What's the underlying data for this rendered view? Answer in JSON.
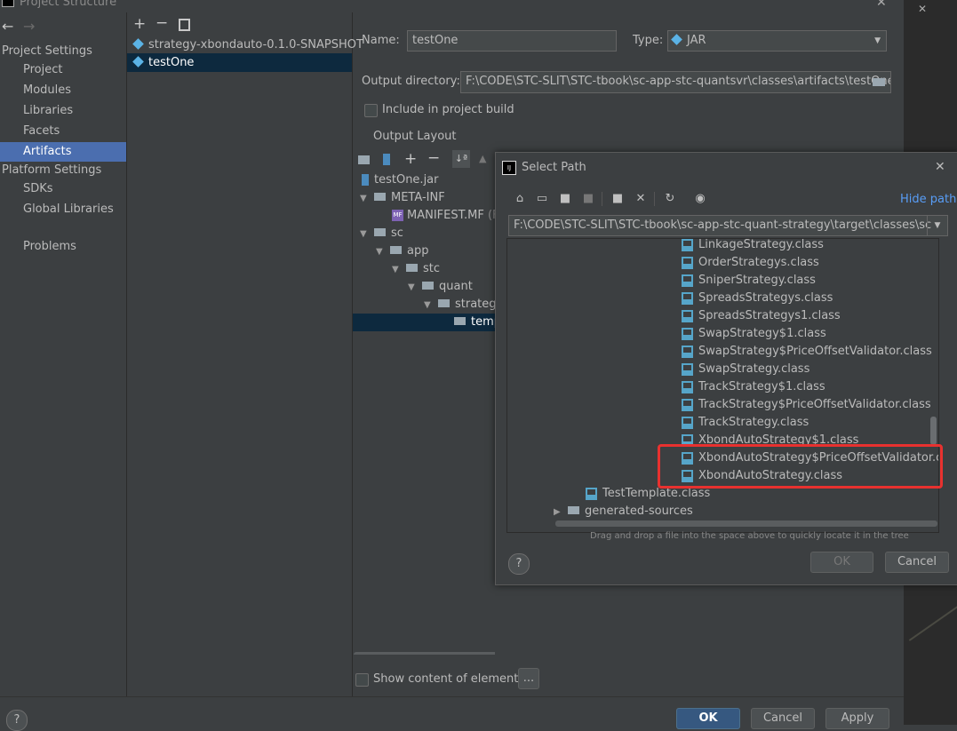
{
  "window": {
    "title": "Project Structure"
  },
  "nav": {
    "project_settings": "Project Settings",
    "items1": [
      "Project",
      "Modules",
      "Libraries",
      "Facets",
      "Artifacts"
    ],
    "platform_settings": "Platform Settings",
    "items2": [
      "SDKs",
      "Global Libraries"
    ],
    "problems": "Problems"
  },
  "artifacts": [
    "strategy-xbondauto-0.1.0-SNAPSHOT",
    "testOne"
  ],
  "form": {
    "name_label": "Name:",
    "name_value": "testOne",
    "type_label": "Type:",
    "type_value": "JAR",
    "output_label": "Output directory:",
    "output_value": "F:\\CODE\\STC-SLIT\\STC-tbook\\sc-app-stc-quantsvr\\classes\\artifacts\\testOne",
    "include_label": "Include in project build",
    "output_layout": "Output Layout",
    "show_content": "Show content of elements",
    "dots": "..."
  },
  "layout_tree": {
    "jar": "testOne.jar",
    "meta_inf": "META-INF",
    "manifest": "MANIFEST.MF",
    "manifest_suffix": "(F:",
    "sc": "sc",
    "app": "app",
    "stc": "stc",
    "quant": "quant",
    "strategy": "strategy",
    "temp": "temp"
  },
  "dialog": {
    "title": "Select Path",
    "hide_path": "Hide path",
    "path_value": "F:\\CODE\\STC-SLIT\\STC-tbook\\sc-app-stc-quant-strategy\\target\\classes\\sc",
    "files": [
      "LinkageStrategy.class",
      "OrderStrategys.class",
      "SniperStrategy.class",
      "SpreadsStrategys.class",
      "SpreadsStrategys1.class",
      "SwapStrategy$1.class",
      "SwapStrategy$PriceOffsetValidator.class",
      "SwapStrategy.class",
      "TrackStrategy$1.class",
      "TrackStrategy$PriceOffsetValidator.class",
      "TrackStrategy.class",
      "XbondAutoStrategy$1.class",
      "XbondAutoStrategy$PriceOffsetValidator.class",
      "XbondAutoStrategy.class"
    ],
    "test_template": "TestTemplate.class",
    "generated_sources": "generated-sources",
    "hint": "Drag and drop a file into the space above to quickly locate it in the tree",
    "ok": "OK",
    "cancel": "Cancel",
    "help": "?"
  },
  "bottom": {
    "ok": "OK",
    "cancel": "Cancel",
    "apply": "Apply",
    "help": "?"
  },
  "colors": {
    "selection": "#4b6eaf",
    "highlight": "#e8312f",
    "primary": "#365880"
  }
}
